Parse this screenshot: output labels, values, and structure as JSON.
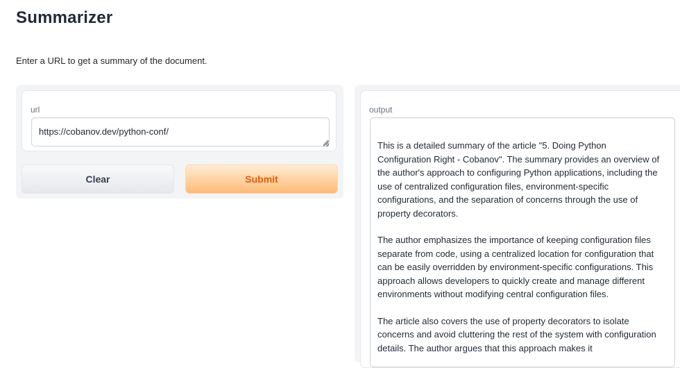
{
  "app": {
    "title": "Summarizer",
    "description": "Enter a URL to get a summary of the document."
  },
  "input": {
    "label": "url",
    "value": "https://cobanov.dev/python-conf/"
  },
  "buttons": {
    "clear_label": "Clear",
    "submit_label": "Submit"
  },
  "output": {
    "label": "output",
    "paragraphs": [
      "This is a detailed summary of the article \"5. Doing Python Configuration Right - Cobanov\". The summary provides an overview of the author's approach to configuring Python applications, including the use of centralized configuration files, environment-specific configurations, and the separation of concerns through the use of property decorators.",
      "The author emphasizes the importance of keeping configuration files separate from code, using a centralized location for configuration that can be easily overridden by environment-specific configurations. This approach allows developers to quickly create and manage different environments without modifying central configuration files.",
      "The article also covers the use of property decorators to isolate concerns and avoid cluttering the rest of the system with configuration details. The author argues that this approach makes it"
    ]
  },
  "colors": {
    "accent": "#ea580c",
    "submit_gradient_top": "#ffedd5",
    "submit_gradient_bottom": "#fdba74",
    "panel_background": "#f3f4f6"
  }
}
